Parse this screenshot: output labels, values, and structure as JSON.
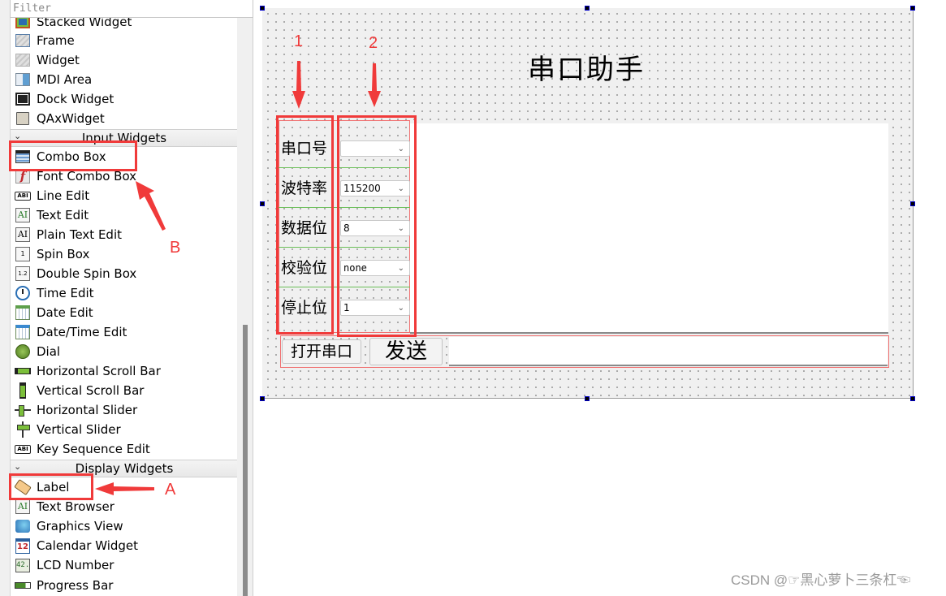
{
  "widget_box": {
    "filter_placeholder": "Filter",
    "containers_items": [
      {
        "label": "Stacked Widget",
        "icon": "stacked-widget-icon"
      },
      {
        "label": "Frame",
        "icon": "frame-icon"
      },
      {
        "label": "Widget",
        "icon": "widget-icon"
      },
      {
        "label": "MDI Area",
        "icon": "mdi-area-icon"
      },
      {
        "label": "Dock Widget",
        "icon": "dock-widget-icon"
      },
      {
        "label": "QAxWidget",
        "icon": "qaxwidget-icon"
      }
    ],
    "input_category": "Input Widgets",
    "input_items": [
      {
        "label": "Combo Box",
        "icon": "combo-box-icon"
      },
      {
        "label": "Font Combo Box",
        "icon": "font-combo-box-icon"
      },
      {
        "label": "Line Edit",
        "icon": "line-edit-icon"
      },
      {
        "label": "Text Edit",
        "icon": "text-edit-icon"
      },
      {
        "label": "Plain Text Edit",
        "icon": "plain-text-edit-icon"
      },
      {
        "label": "Spin Box",
        "icon": "spin-box-icon"
      },
      {
        "label": "Double Spin Box",
        "icon": "double-spin-box-icon"
      },
      {
        "label": "Time Edit",
        "icon": "time-edit-icon"
      },
      {
        "label": "Date Edit",
        "icon": "date-edit-icon"
      },
      {
        "label": "Date/Time Edit",
        "icon": "date-time-edit-icon"
      },
      {
        "label": "Dial",
        "icon": "dial-icon"
      },
      {
        "label": "Horizontal Scroll Bar",
        "icon": "horizontal-scroll-bar-icon"
      },
      {
        "label": "Vertical Scroll Bar",
        "icon": "vertical-scroll-bar-icon"
      },
      {
        "label": "Horizontal Slider",
        "icon": "horizontal-slider-icon"
      },
      {
        "label": "Vertical Slider",
        "icon": "vertical-slider-icon"
      },
      {
        "label": "Key Sequence Edit",
        "icon": "key-sequence-edit-icon"
      }
    ],
    "display_category": "Display Widgets",
    "display_items": [
      {
        "label": "Label",
        "icon": "label-icon"
      },
      {
        "label": "Text Browser",
        "icon": "text-browser-icon"
      },
      {
        "label": "Graphics View",
        "icon": "graphics-view-icon"
      },
      {
        "label": "Calendar Widget",
        "icon": "calendar-widget-icon"
      },
      {
        "label": "LCD Number",
        "icon": "lcd-number-icon"
      },
      {
        "label": "Progress Bar",
        "icon": "progress-bar-icon"
      }
    ],
    "icon_glyphs": {
      "line_edit": "ABI",
      "text_edit": "AI",
      "spin_box": "1",
      "double_spin_box": "1.2",
      "calendar": "12",
      "lcd": "42."
    }
  },
  "form": {
    "title": "串口助手",
    "fields": [
      {
        "label": "串口号",
        "value": ""
      },
      {
        "label": "波特率",
        "value": "115200"
      },
      {
        "label": "数据位",
        "value": "8"
      },
      {
        "label": "校验位",
        "value": "none"
      },
      {
        "label": "停止位",
        "value": "1"
      }
    ],
    "open_port_button": "打开串口",
    "send_button": "发送",
    "send_input_value": ""
  },
  "annotations": {
    "marker_1": "1",
    "marker_2": "2",
    "marker_a": "A",
    "marker_b": "B",
    "color": "#f03a3a"
  },
  "watermark": "CSDN @☞黑心萝卜三条杠☜"
}
